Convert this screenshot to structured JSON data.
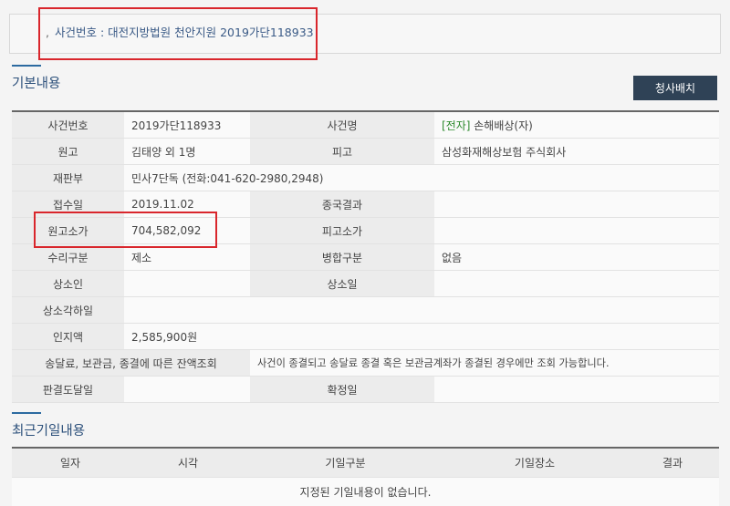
{
  "case_header": {
    "bullet": ",",
    "text": "사건번호 : 대전지방법원 천안지원 2019가단118933"
  },
  "basic_section": {
    "title": "기본내용",
    "button_label": "청사배치",
    "rows": [
      {
        "l1": "사건번호",
        "v1": "2019가단118933",
        "l2": "사건명",
        "v2_tag": "[전자]",
        "v2": " 손해배상(자)"
      },
      {
        "l1": "원고",
        "v1": "김태양 외 1명",
        "l2": "피고",
        "v2": "삼성화재해상보험 주식회사"
      },
      {
        "l1": "재판부",
        "v1": "민사7단독 (전화:041-620-2980,2948)"
      },
      {
        "l1": "접수일",
        "v1": "2019.11.02",
        "l2": "종국결과",
        "v2": ""
      },
      {
        "l1": "원고소가",
        "v1": "704,582,092",
        "l2": "피고소가",
        "v2": ""
      },
      {
        "l1": "수리구분",
        "v1": "제소",
        "l2": "병합구분",
        "v2": "없음"
      },
      {
        "l1": "상소인",
        "v1": "",
        "l2": "상소일",
        "v2": ""
      },
      {
        "l1": "상소각하일",
        "v1": ""
      },
      {
        "l1": "인지액",
        "v1": "2,585,900원"
      },
      {
        "l1": "송달료, 보관금, 종결에 따른 잔액조회",
        "v1": "사건이 종결되고 송달료 종결 혹은 보관금계좌가 종결된 경우에만 조회 가능합니다."
      },
      {
        "l1": "판결도달일",
        "v1": "",
        "l2": "확정일",
        "v2": ""
      }
    ]
  },
  "recent_section": {
    "title": "최근기일내용",
    "headers": [
      "일자",
      "시각",
      "기일구분",
      "기일장소",
      "결과"
    ],
    "empty_message": "지정된 기일내용이 없습니다."
  }
}
